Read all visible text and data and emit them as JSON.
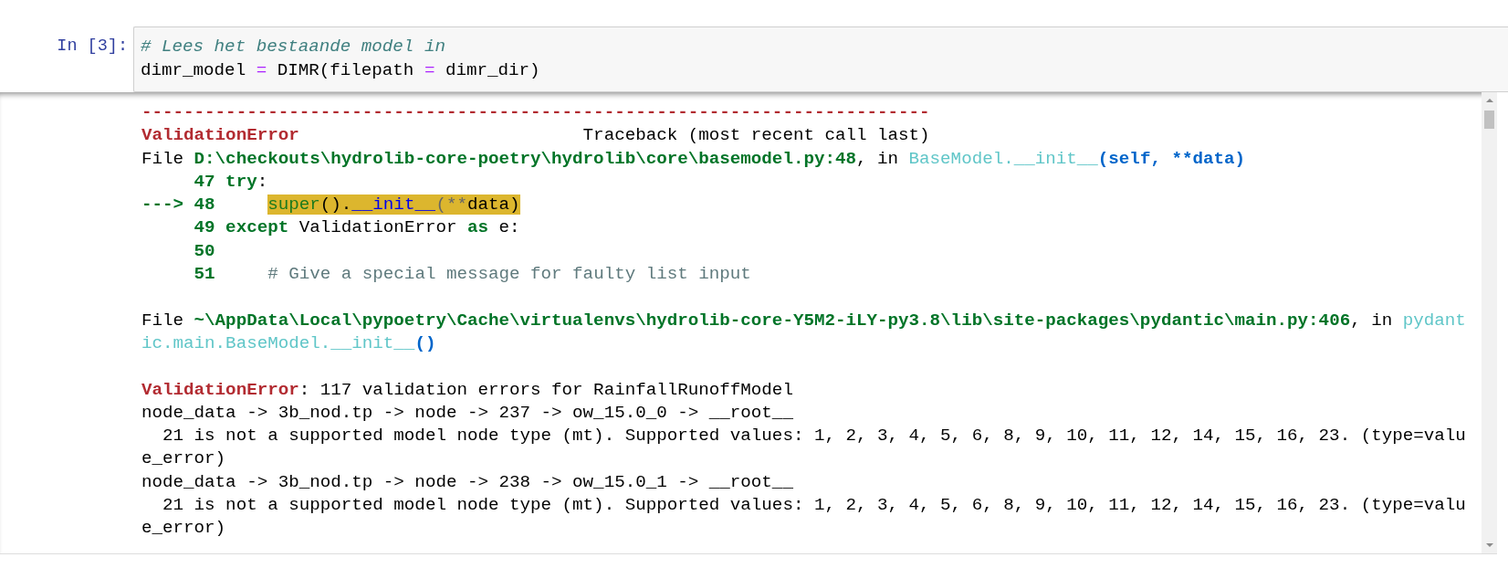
{
  "cell": {
    "prompt": "In [3]:",
    "code": [
      [
        {
          "kind": "comment",
          "text": "# Lees het bestaande model in"
        }
      ],
      [
        {
          "kind": "plain",
          "text": "dimr_model "
        },
        {
          "kind": "operator",
          "text": "="
        },
        {
          "kind": "plain",
          "text": " DIMR(filepath "
        },
        {
          "kind": "operator",
          "text": "="
        },
        {
          "kind": "plain",
          "text": " dimr_dir)"
        }
      ]
    ]
  },
  "output": {
    "lines": [
      {
        "kind": "text",
        "segments": [
          {
            "kind": "error",
            "text": "---------------------------------------------------------------------------"
          }
        ]
      },
      {
        "kind": "text",
        "segments": [
          {
            "kind": "error",
            "text": "ValidationError"
          },
          {
            "kind": "plain",
            "text": "                           Traceback (most recent call last)"
          }
        ]
      },
      {
        "kind": "text",
        "segments": [
          {
            "kind": "plain",
            "text": "File "
          },
          {
            "kind": "path",
            "text": "D:\\checkouts\\hydrolib-core-poetry\\hydrolib\\core\\basemodel.py:48"
          },
          {
            "kind": "plain",
            "text": ", in "
          },
          {
            "kind": "func",
            "text": "BaseModel.__init__"
          },
          {
            "kind": "args",
            "text": "(self, **data)"
          }
        ]
      },
      {
        "kind": "text",
        "segments": [
          {
            "kind": "lineno",
            "text": "     47"
          },
          {
            "kind": "keyword",
            "text": " try"
          },
          {
            "kind": "plain",
            "text": ":"
          }
        ]
      },
      {
        "kind": "text",
        "segments": [
          {
            "kind": "arrow",
            "text": "---> 48     "
          },
          {
            "kind": "hl-builtin",
            "text": "super"
          },
          {
            "kind": "hl-plain",
            "text": "()."
          },
          {
            "kind": "hl-dunder",
            "text": "__init__"
          },
          {
            "kind": "hl-op",
            "text": "(**"
          },
          {
            "kind": "hl-plain",
            "text": "data)"
          }
        ]
      },
      {
        "kind": "text",
        "segments": [
          {
            "kind": "lineno",
            "text": "     49"
          },
          {
            "kind": "keyword",
            "text": " except"
          },
          {
            "kind": "plain",
            "text": " ValidationError "
          },
          {
            "kind": "keyword",
            "text": "as"
          },
          {
            "kind": "plain",
            "text": " e:"
          }
        ]
      },
      {
        "kind": "text",
        "segments": [
          {
            "kind": "lineno",
            "text": "     50"
          }
        ]
      },
      {
        "kind": "text",
        "segments": [
          {
            "kind": "lineno",
            "text": "     51"
          },
          {
            "kind": "comment2",
            "text": "     # Give a special message for faulty list input"
          }
        ]
      },
      {
        "kind": "blank"
      },
      {
        "kind": "text",
        "segments": [
          {
            "kind": "plain",
            "text": "File "
          },
          {
            "kind": "path",
            "text": "~\\AppData\\Local\\pypoetry\\Cache\\virtualenvs\\hydrolib-core-Y5M2-iLY-py3.8\\lib\\site-packages\\pydantic\\main.py:406"
          },
          {
            "kind": "plain",
            "text": ", in "
          },
          {
            "kind": "func",
            "text": "pydant"
          }
        ]
      },
      {
        "kind": "text",
        "segments": [
          {
            "kind": "func",
            "text": "ic.main.BaseModel.__init__"
          },
          {
            "kind": "args",
            "text": "()"
          }
        ]
      },
      {
        "kind": "blank"
      },
      {
        "kind": "text",
        "segments": [
          {
            "kind": "error",
            "text": "ValidationError"
          },
          {
            "kind": "plain",
            "text": ": 117 validation errors for RainfallRunoffModel"
          }
        ]
      },
      {
        "kind": "text",
        "segments": [
          {
            "kind": "plain",
            "text": "node_data -> 3b_nod.tp -> node -> 237 -> ow_15.0_0 -> __root__"
          }
        ]
      },
      {
        "kind": "text",
        "segments": [
          {
            "kind": "plain",
            "text": "  21 is not a supported model node type (mt). Supported values: 1, 2, 3, 4, 5, 6, 8, 9, 10, 11, 12, 14, 15, 16, 23. (type=valu"
          }
        ]
      },
      {
        "kind": "text",
        "segments": [
          {
            "kind": "plain",
            "text": "e_error)"
          }
        ]
      },
      {
        "kind": "text",
        "segments": [
          {
            "kind": "plain",
            "text": "node_data -> 3b_nod.tp -> node -> 238 -> ow_15.0_1 -> __root__"
          }
        ]
      },
      {
        "kind": "text",
        "segments": [
          {
            "kind": "plain",
            "text": "  21 is not a supported model node type (mt). Supported values: 1, 2, 3, 4, 5, 6, 8, 9, 10, 11, 12, 14, 15, 16, 23. (type=valu"
          }
        ]
      },
      {
        "kind": "text",
        "segments": [
          {
            "kind": "plain",
            "text": "e_error)"
          }
        ]
      }
    ]
  }
}
